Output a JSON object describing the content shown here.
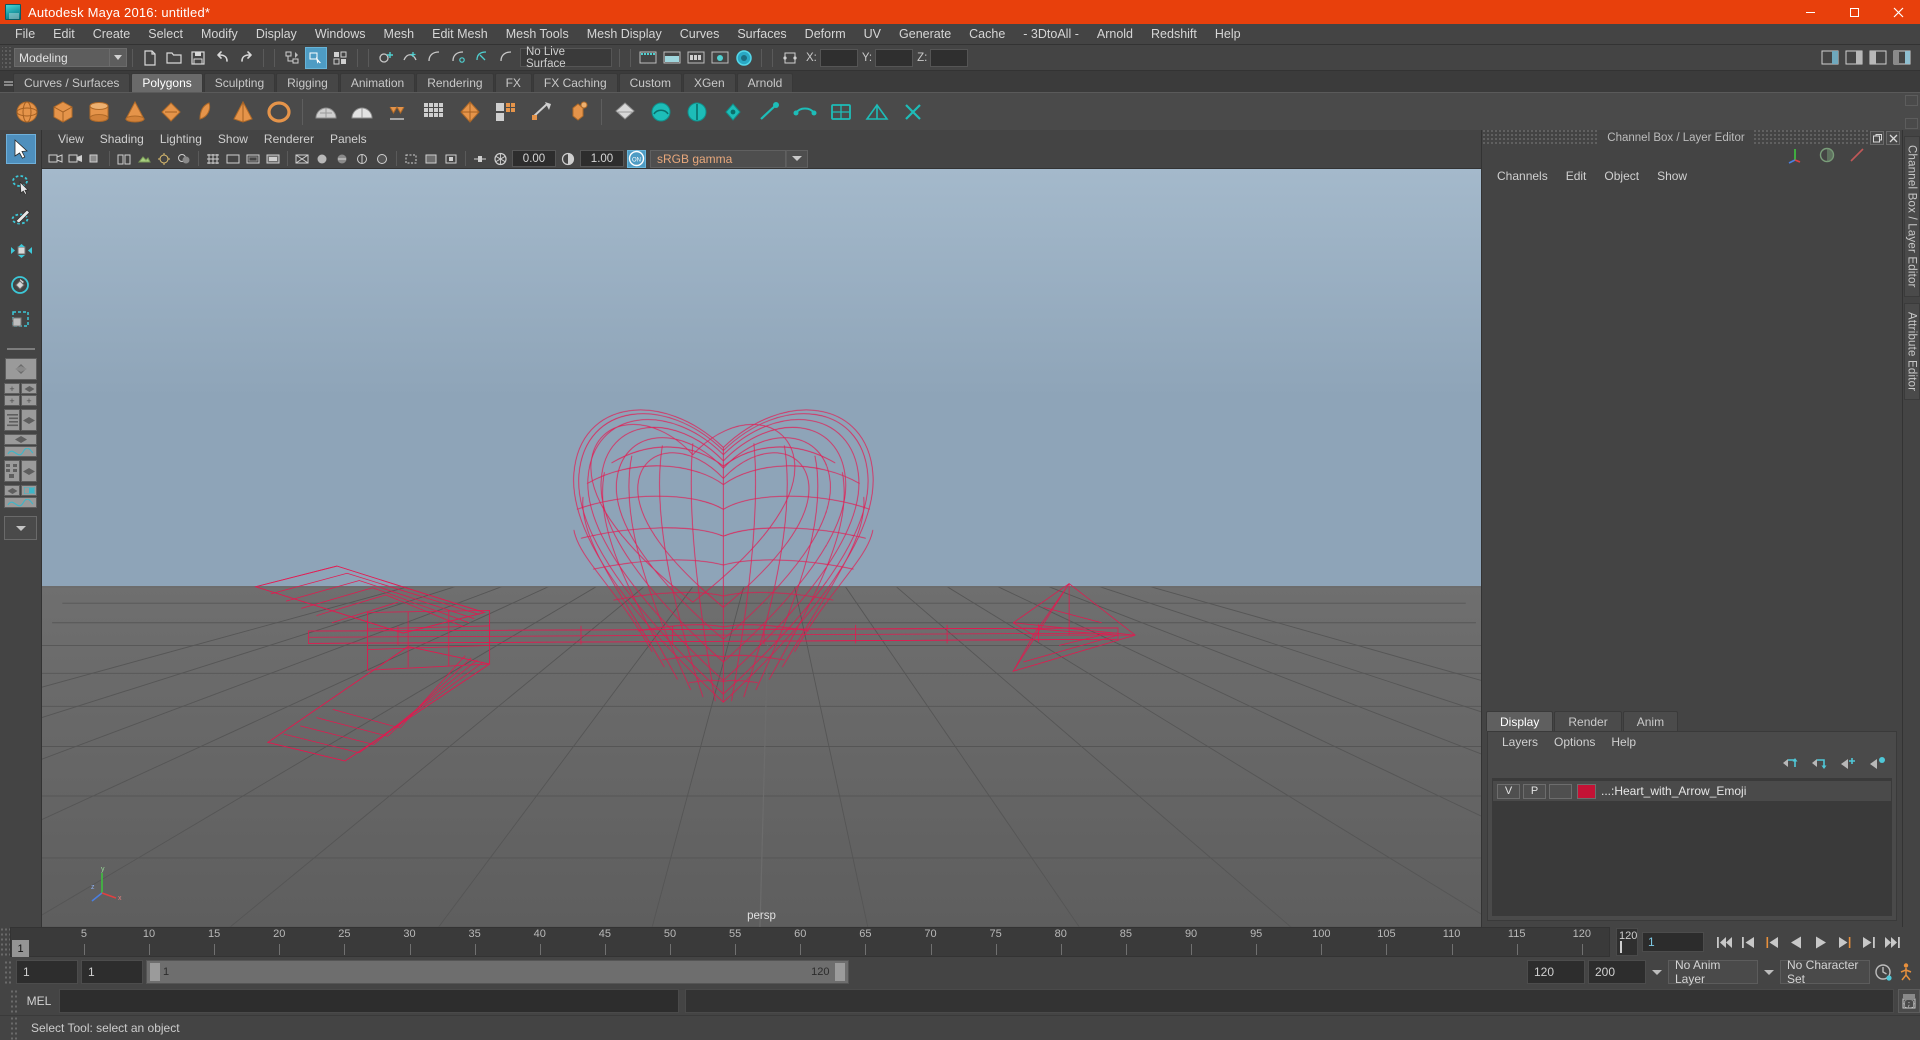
{
  "window": {
    "title": "Autodesk Maya 2016: untitled*",
    "logo_icon": "maya-logo-icon",
    "minimize_label": "–",
    "maximize_label": "❐",
    "close_label": "✕"
  },
  "menubar": {
    "items": [
      "File",
      "Edit",
      "Create",
      "Select",
      "Modify",
      "Display",
      "Windows",
      "Mesh",
      "Edit Mesh",
      "Mesh Tools",
      "Mesh Display",
      "Curves",
      "Surfaces",
      "Deform",
      "UV",
      "Generate",
      "Cache",
      "- 3DtoAll -",
      "Arnold",
      "Redshift",
      "Help"
    ]
  },
  "statusline": {
    "menuset_value": "Modeling",
    "live_surface_value": "No Live Surface",
    "coord_x_label": "X:",
    "coord_y_label": "Y:",
    "coord_z_label": "Z:",
    "coord_x_value": "",
    "coord_y_value": "",
    "coord_z_value": "",
    "icons": [
      "new-scene-icon",
      "open-scene-icon",
      "save-scene-icon",
      "undo-icon",
      "redo-icon",
      "select-by-hierarchy-icon",
      "select-by-object-icon",
      "select-by-component-icon",
      "snap-to-grid-icon",
      "snap-to-curve-icon",
      "snap-to-point-icon",
      "snap-to-projected-center-icon",
      "snap-to-view-plane-icon",
      "make-live-icon",
      "render-current-frame-icon",
      "ipr-render-icon",
      "render-settings-icon",
      "hypershade-icon",
      "render-view-icon"
    ]
  },
  "shelf": {
    "tabs": [
      "Curves / Surfaces",
      "Polygons",
      "Sculpting",
      "Rigging",
      "Animation",
      "Rendering",
      "FX",
      "FX Caching",
      "Custom",
      "XGen",
      "Arnold"
    ],
    "selected_tab": "Polygons",
    "icons": [
      "poly-sphere-icon",
      "poly-cube-icon",
      "poly-cylinder-icon",
      "poly-cone-icon",
      "poly-torus-icon",
      "poly-plane-icon",
      "poly-disc-icon",
      "poly-platonic-icon",
      "poly-pyramid-icon",
      "poly-prism-icon",
      "poly-pipe-icon",
      "poly-helix-icon",
      "poly-gear-icon",
      "poly-soccer-ball-icon",
      "poly-super-ellipse-icon",
      "sculpt-geometry-icon",
      "combine-icon",
      "separate-icon",
      "booleans-icon",
      "smooth-icon",
      "extrude-icon",
      "bevel-icon",
      "bridge-icon",
      "merge-icon",
      "multi-cut-icon",
      "target-weld-icon",
      "quad-draw-icon",
      "mirror-icon",
      "append-polygon-icon",
      "insert-edge-loop-icon",
      "offset-edge-loop-icon",
      "crease-tool-icon",
      "uv-editor-icon",
      "delete-edge-icon"
    ]
  },
  "toolbox": {
    "tools": [
      {
        "name": "select-tool",
        "selected": true
      },
      {
        "name": "lasso-select-tool",
        "selected": false
      },
      {
        "name": "paint-select-tool",
        "selected": false
      },
      {
        "name": "move-tool",
        "selected": false
      },
      {
        "name": "rotate-tool",
        "selected": false
      },
      {
        "name": "scale-tool",
        "selected": false
      },
      {
        "name": "last-tool-used",
        "selected": false
      }
    ],
    "layouts": [
      "single-perspective-layout",
      "four-view-layout",
      "outliner-persp-layout",
      "persp-graph-layout",
      "hypershade-persp-layout",
      "persp-render-layout",
      "more-layouts-dropdown"
    ]
  },
  "viewport": {
    "menus": [
      "View",
      "Shading",
      "Lighting",
      "Show",
      "Renderer",
      "Panels"
    ],
    "camera_label": "persp",
    "toolbar": {
      "exposure_value": "0.00",
      "gamma_value": "1.00",
      "color_management_toggle": "ON",
      "view_transform": "sRGB gamma",
      "icons": [
        "select-camera-icon",
        "lock-camera-icon",
        "camera-attributes-icon",
        "book-icon",
        "image-plane-icon",
        "two-sided-lighting-icon",
        "shadows-icon",
        "grid-toggle-icon",
        "film-gate-icon",
        "resolution-gate-icon",
        "gate-mask-icon",
        "wireframe-icon",
        "smooth-shade-all-icon",
        "smooth-shade-textured-icon",
        "use-all-lights-icon",
        "shadows-toggle-icon",
        "ambient-occlusion-icon",
        "motion-blur-icon",
        "multisample-icon",
        "isolate-select-icon",
        "xray-icon",
        "xray-joints-icon",
        "xray-active-components-icon",
        "exposure-icon",
        "gamma-icon"
      ]
    },
    "scene": {
      "object_name": "Heart_with_Arrow_Emoji",
      "wireframe_color": "#e8164f",
      "background_top": "#9fb5c8",
      "background_bottom": "#636363",
      "grid_color": "#555555"
    },
    "axis_gizmo": {
      "x_label": "x",
      "y_label": "y",
      "z_label": "z"
    }
  },
  "right_panel": {
    "header_title": "Channel Box / Layer Editor",
    "undock_label": "❐",
    "close_label": "✕",
    "channelbox_menus": [
      "Channels",
      "Edit",
      "Object",
      "Show"
    ],
    "layer_editor_tabs": [
      "Display",
      "Render",
      "Anim"
    ],
    "layer_editor_selected_tab": "Display",
    "layer_menus": [
      "Layers",
      "Options",
      "Help"
    ],
    "layer_tool_icons": [
      "move-layer-up-icon",
      "move-layer-down-icon",
      "new-layer-icon",
      "new-layer-from-selected-icon"
    ],
    "layers": [
      {
        "visibility": "V",
        "playback": "P",
        "display_type": "",
        "color": "#c41235",
        "name": "...:Heart_with_Arrow_Emoji"
      }
    ],
    "vertical_tabs": [
      "Channel Box / Layer Editor",
      "Attribute Editor"
    ]
  },
  "timeline": {
    "tick_labels": [
      "5",
      "10",
      "15",
      "20",
      "25",
      "30",
      "35",
      "40",
      "45",
      "50",
      "55",
      "60",
      "65",
      "70",
      "75",
      "80",
      "85",
      "90",
      "95",
      "100",
      "105",
      "110",
      "115",
      "120"
    ],
    "tick_values": [
      5,
      10,
      15,
      20,
      25,
      30,
      35,
      40,
      45,
      50,
      55,
      60,
      65,
      70,
      75,
      80,
      85,
      90,
      95,
      100,
      105,
      110,
      115,
      120
    ],
    "range_start": 1,
    "range_end": 120,
    "current_frame_label": "1",
    "end_marker_label": "120",
    "current_frame_input": "1",
    "playback_buttons": [
      "go-to-start-icon",
      "step-back-keyframe-icon",
      "step-back-frame-icon",
      "play-backwards-icon",
      "play-forwards-icon",
      "step-forward-frame-icon",
      "step-forward-keyframe-icon",
      "go-to-end-icon"
    ]
  },
  "range_row": {
    "anim_start": "1",
    "playback_start": "1",
    "range_slider_start_label": "1",
    "range_slider_end_label": "120",
    "playback_end": "120",
    "anim_end": "200",
    "anim_layer_value": "No Anim Layer",
    "character_set_value": "No Character Set",
    "auto_key_icon": "auto-keyframe-icon",
    "anim_prefs_icon": "animation-preferences-icon"
  },
  "command_line": {
    "language_label": "MEL",
    "input_value": "",
    "output_value": "",
    "script_editor_icon": "script-editor-icon"
  },
  "status_bar": {
    "message": "Select Tool: select an object"
  }
}
